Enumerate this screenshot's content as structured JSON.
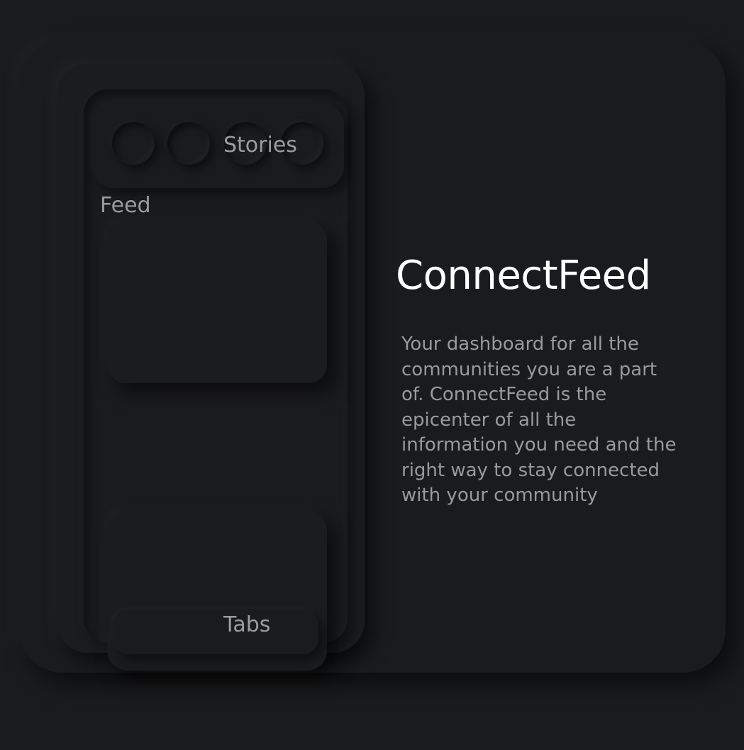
{
  "phone_mockup": {
    "stories_label": "Stories",
    "feed_label": "Feed",
    "tabs_label": "Tabs",
    "story_count": 4
  },
  "hero": {
    "title": "ConnectFeed",
    "description": "Your dashboard for all the communities you are a part of.  ConnectFeed is the epicenter of all the information you need and the right way to stay connected with your community"
  },
  "colors": {
    "background": "#1a1b1d",
    "title": "#ffffff",
    "body_text": "#9a9a9a"
  }
}
